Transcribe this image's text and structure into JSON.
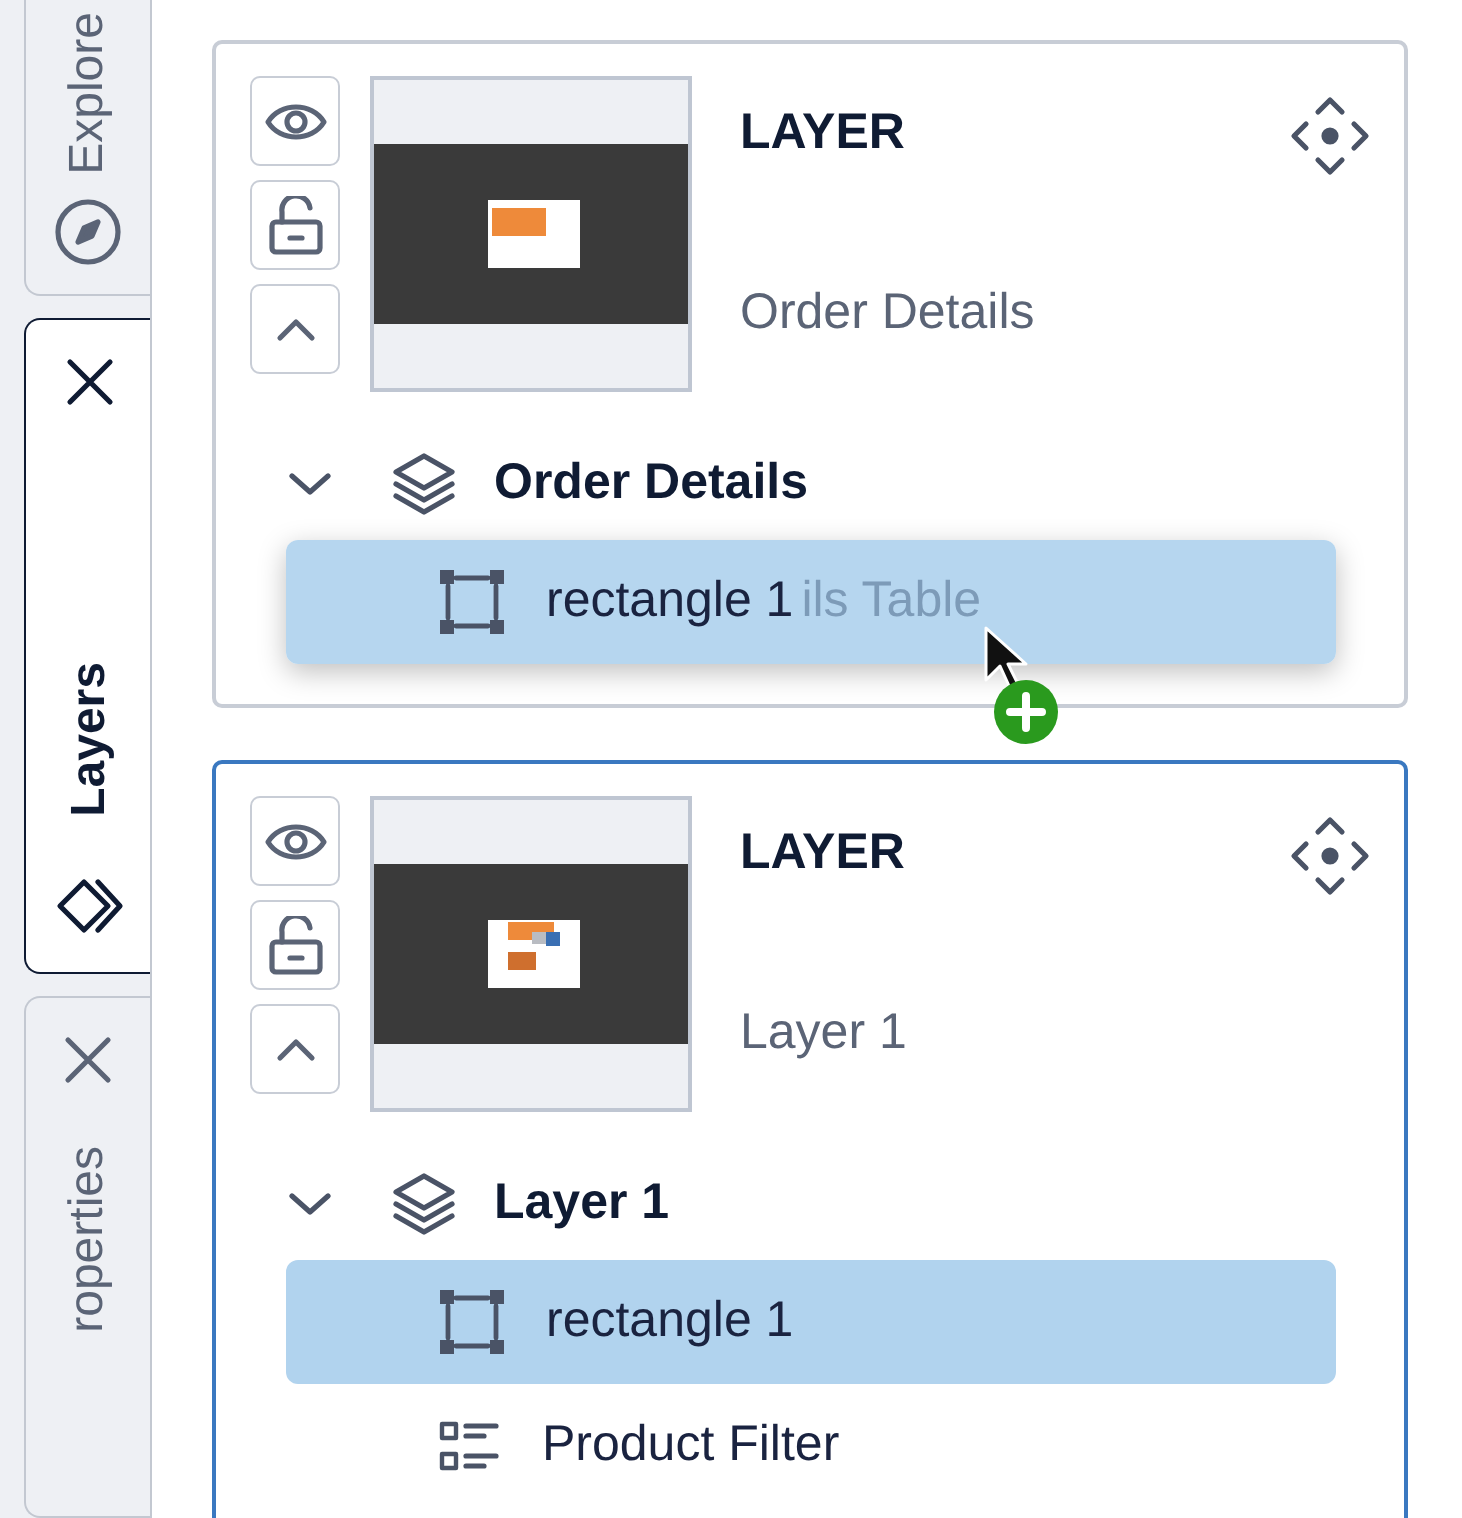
{
  "side_tabs": [
    {
      "kind": "explorer",
      "label": "Explore",
      "selected": false,
      "closable": false
    },
    {
      "kind": "layers",
      "label": "Layers",
      "selected": true,
      "closable": true
    },
    {
      "kind": "properties",
      "label": "roperties",
      "selected": false,
      "closable": true
    }
  ],
  "layers": [
    {
      "heading": "LAYER",
      "name": "Order Details",
      "selected": false,
      "tree": {
        "label": "Order Details",
        "expanded": true,
        "children": [
          {
            "label": "ils Table",
            "selected": false
          }
        ]
      },
      "drag_ghost": {
        "kind": "rectangle",
        "label": "rectangle 1"
      }
    },
    {
      "heading": "LAYER",
      "name": "Layer 1",
      "selected": true,
      "tree": {
        "label": "Layer 1",
        "expanded": true,
        "children": [
          {
            "kind": "rectangle",
            "label": "rectangle 1",
            "selected": true
          },
          {
            "kind": "filter",
            "label": "Product Filter",
            "selected": false
          }
        ]
      }
    }
  ]
}
